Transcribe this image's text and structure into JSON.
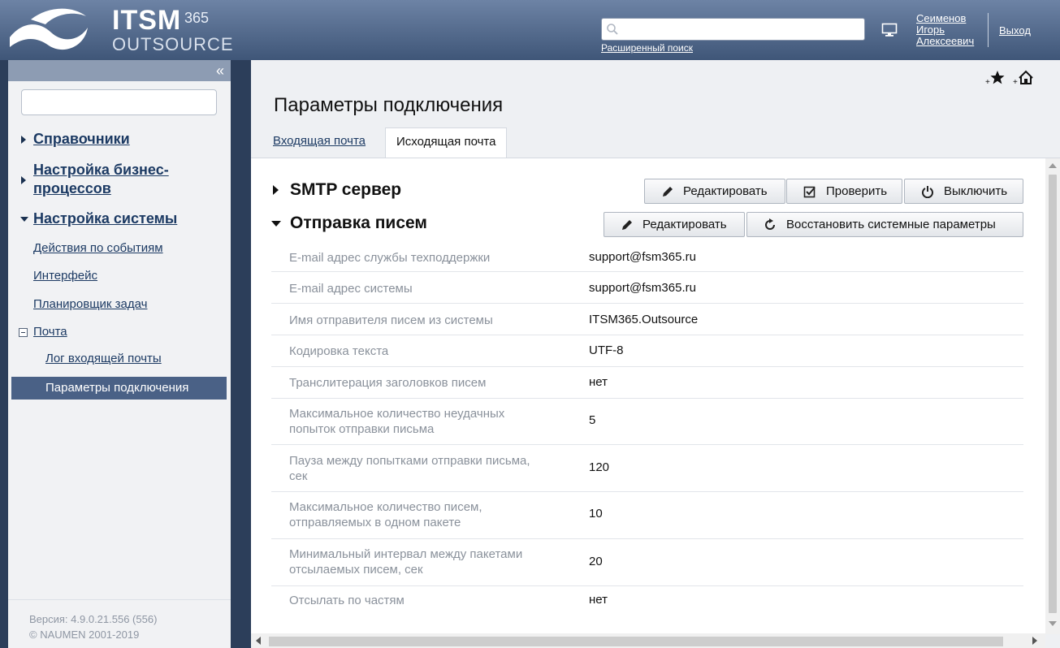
{
  "header": {
    "logo_main": "ITSM",
    "logo_sup": "365",
    "logo_sub": "OUTSOURCE",
    "search_placeholder": "",
    "advanced_search": "Расширенный поиск",
    "user_last_name": "Сеименов",
    "user_first_name": "Игорь",
    "user_patronymic": "Алексеевич",
    "logout": "Выход"
  },
  "sidebar": {
    "collapse_icon": "«",
    "items": [
      {
        "label": "Справочники"
      },
      {
        "label": "Настройка бизнес-процессов"
      },
      {
        "label": "Настройка системы"
      },
      {
        "label": "Действия по событиям"
      },
      {
        "label": "Интерфейс"
      },
      {
        "label": "Планировщик задач"
      },
      {
        "label": "Почта"
      },
      {
        "label": "Лог входящей почты"
      },
      {
        "label": "Параметры подключения"
      }
    ],
    "version": "Версия: 4.9.0.21.556 (556)",
    "copyright": "© NAUMEN 2001-2019"
  },
  "main": {
    "title": "Параметры подключения",
    "tabs": [
      {
        "label": "Входящая почта",
        "active": false
      },
      {
        "label": "Исходящая почта",
        "active": true
      }
    ],
    "smtp": {
      "title": "SMTP сервер",
      "buttons": {
        "edit": "Редактировать",
        "check": "Проверить",
        "disable": "Выключить"
      }
    },
    "sending": {
      "title": "Отправка писем",
      "buttons": {
        "edit": "Редактировать",
        "restore": "Восстановить системные параметры"
      },
      "rows": [
        {
          "label": "E-mail адрес службы техподдержки",
          "value": "support@fsm365.ru"
        },
        {
          "label": "E-mail адрес системы",
          "value": "support@fsm365.ru"
        },
        {
          "label": "Имя отправителя писем из системы",
          "value": "ITSM365.Outsource"
        },
        {
          "label": "Кодировка текста",
          "value": "UTF-8"
        },
        {
          "label": "Транслитерация заголовков писем",
          "value": "нет"
        },
        {
          "label": "Максимальное количество неудачных попыток отправки письма",
          "value": "5"
        },
        {
          "label": "Пауза между попытками отправки письма, сек",
          "value": "120"
        },
        {
          "label": "Максимальное количество писем, отправляемых в одном пакете",
          "value": "10"
        },
        {
          "label": "Минимальный интервал между пакетами отсылаемых писем, сек",
          "value": "20"
        },
        {
          "label": "Отсылать по частям",
          "value": "нет"
        }
      ]
    }
  },
  "colors": {
    "header_top": "#6d83a5",
    "header_bottom": "#3f5678",
    "sidebar_active": "#4a6186",
    "link": "#1c3a63"
  }
}
